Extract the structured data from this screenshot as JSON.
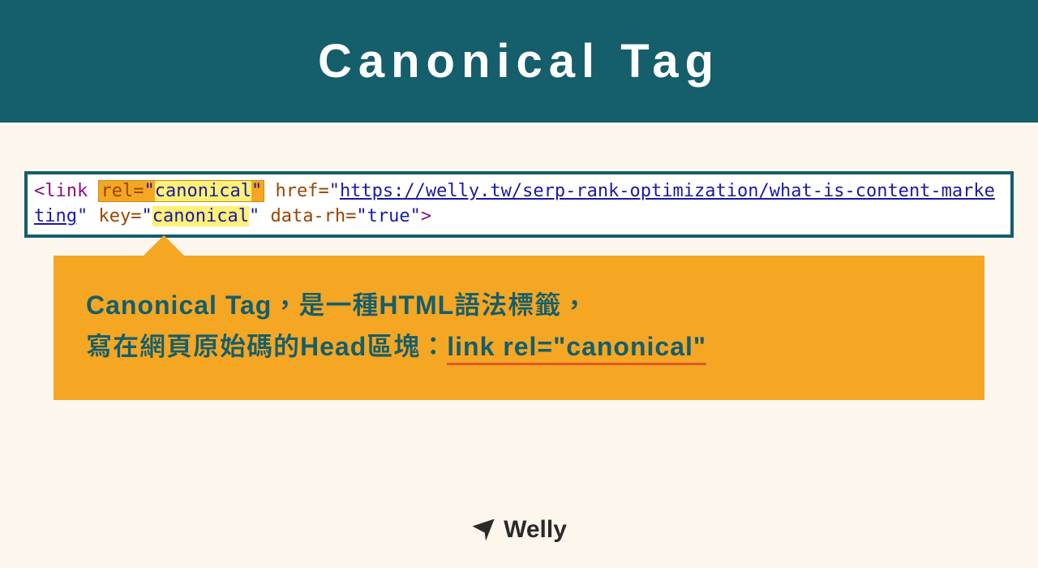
{
  "header": {
    "title": "Canonical Tag"
  },
  "code": {
    "lt": "<",
    "link": "link",
    "rel_attr": "rel",
    "eq": "=",
    "q": "\"",
    "canonical": "canonical",
    "href_attr": "href",
    "url_part1": "https://welly.tw/serp-rank-optimization/what-is-conte",
    "url_part2": "nt-marketing",
    "key_attr": "key",
    "data_rh_attr": "data-rh",
    "true_val": "true",
    "gt": ">"
  },
  "callout": {
    "line1": "Canonical Tag，是一種HTML語法標籤，",
    "line2a": "寫在網頁原始碼的Head區塊：",
    "line2b": "link rel=\"canonical\""
  },
  "brand": {
    "name": "Welly"
  }
}
